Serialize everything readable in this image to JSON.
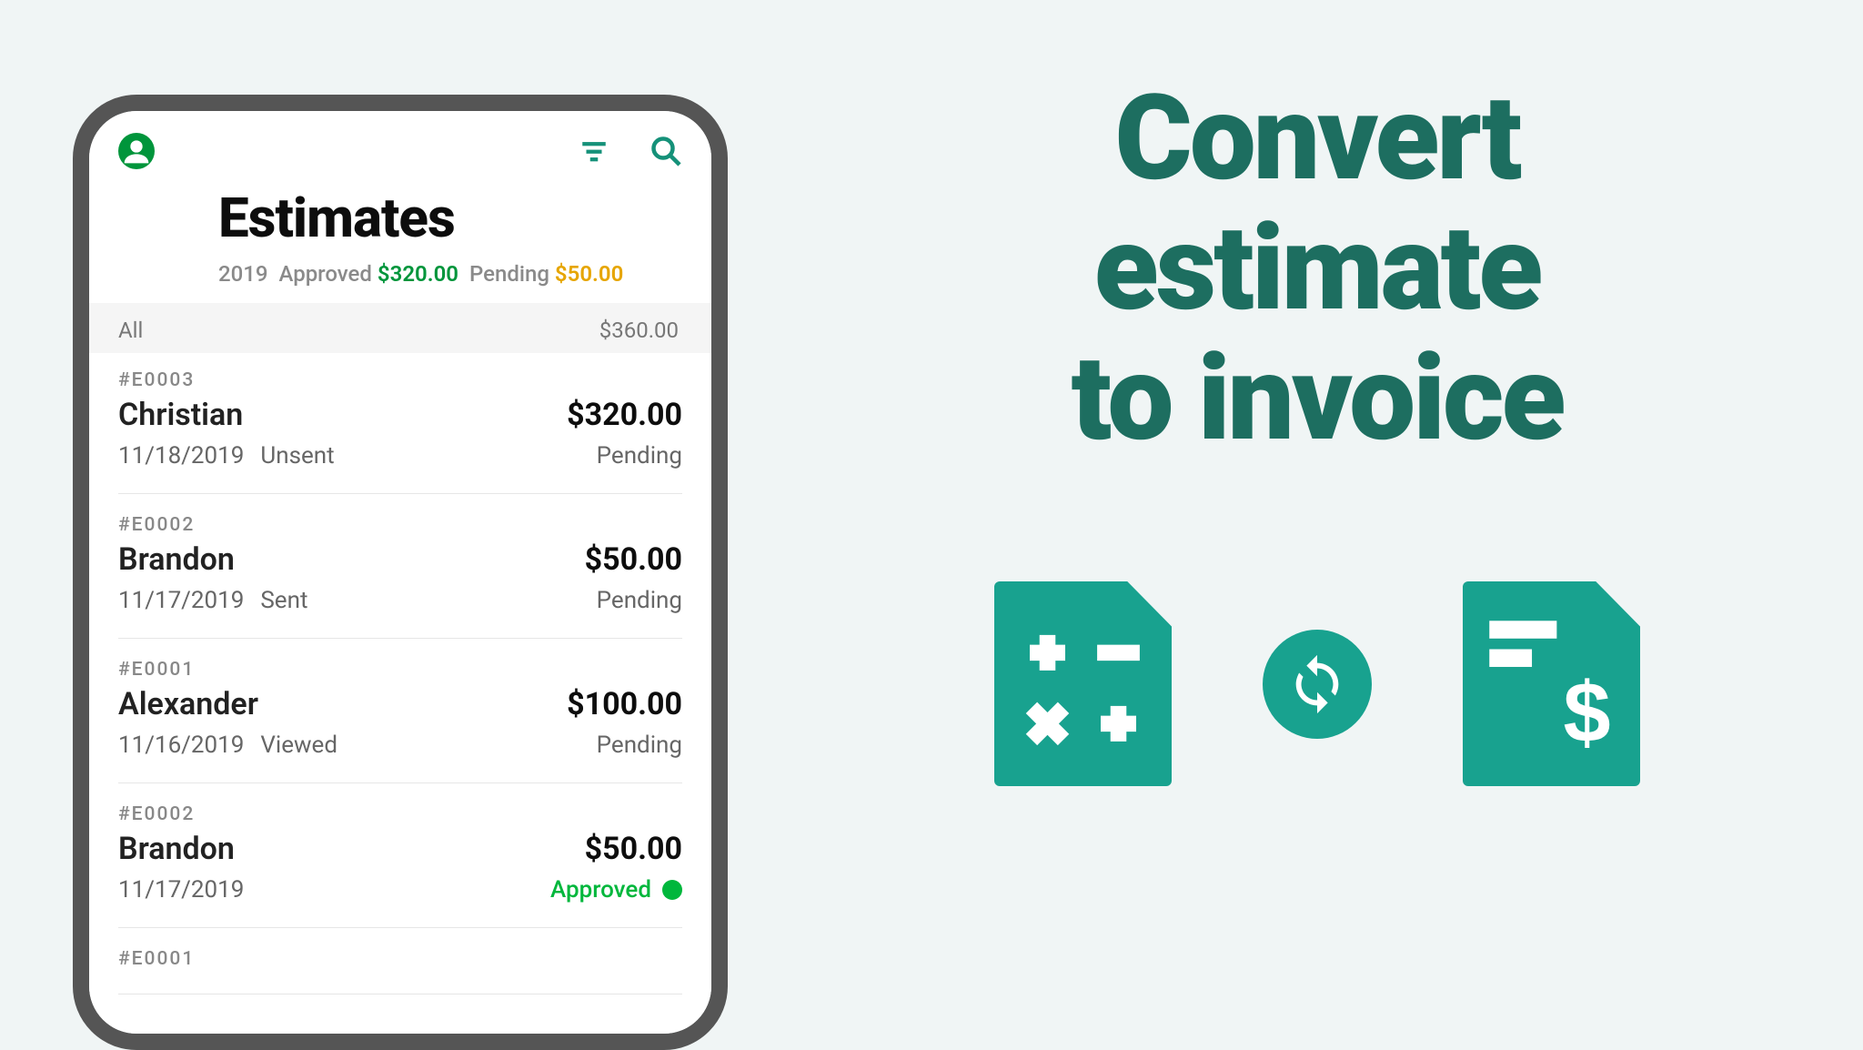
{
  "header": {
    "title": "Estimates",
    "summary": {
      "year": "2019",
      "approved_label": "Approved",
      "approved_amount": "$320.00",
      "pending_label": "Pending",
      "pending_amount": "$50.00"
    }
  },
  "allrow": {
    "label": "All",
    "total": "$360.00"
  },
  "estimates": [
    {
      "id": "#E0003",
      "name": "Christian",
      "amount": "$320.00",
      "date": "11/18/2019",
      "sent_status": "Unsent",
      "pay_status": "Pending",
      "approved": false
    },
    {
      "id": "#E0002",
      "name": "Brandon",
      "amount": "$50.00",
      "date": "11/17/2019",
      "sent_status": "Sent",
      "pay_status": "Pending",
      "approved": false
    },
    {
      "id": "#E0001",
      "name": "Alexander",
      "amount": "$100.00",
      "date": "11/16/2019",
      "sent_status": "Viewed",
      "pay_status": "Pending",
      "approved": false
    },
    {
      "id": "#E0002",
      "name": "Brandon",
      "amount": "$50.00",
      "date": "11/17/2019",
      "sent_status": "",
      "pay_status": "Approved",
      "approved": true
    },
    {
      "id": "#E0001",
      "name": "",
      "amount": "",
      "date": "",
      "sent_status": "",
      "pay_status": "",
      "approved": false
    }
  ],
  "marketing": {
    "line1": "Convert",
    "line2": "estimate",
    "line3": "to invoice"
  }
}
